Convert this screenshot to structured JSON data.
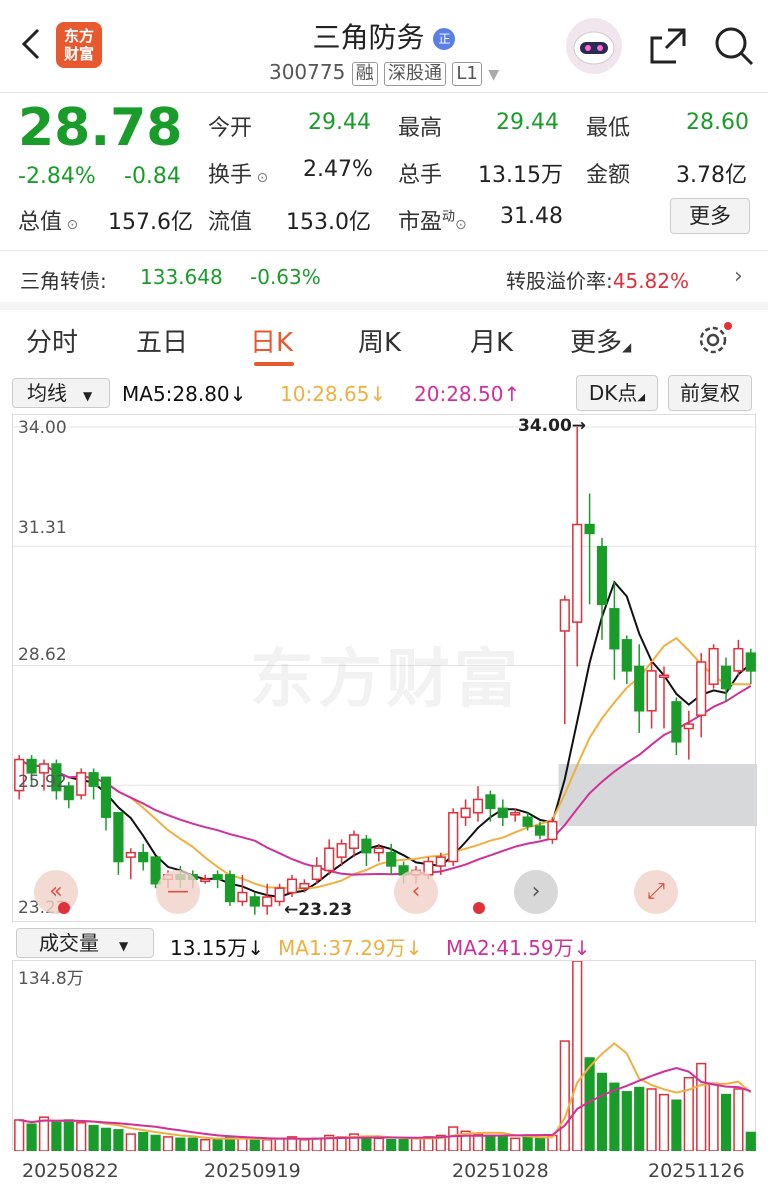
{
  "header": {
    "title": "三角防务",
    "code": "300775",
    "badges": [
      "融",
      "深股通",
      "L1"
    ],
    "logo_text": "东方\n财富",
    "title_badge": "正"
  },
  "quote": {
    "price": "28.78",
    "change_pct": "-2.84%",
    "change": "-0.84",
    "open_label": "今开",
    "open": "29.44",
    "high_label": "最高",
    "high": "29.44",
    "low_label": "最低",
    "low": "28.60",
    "turnover_label": "换手",
    "turnover": "2.47%",
    "volume_label": "总手",
    "volume": "13.15万",
    "amount_label": "金额",
    "amount": "3.78亿",
    "mcap_label": "总值",
    "mcap": "157.6亿",
    "float_label": "流值",
    "float": "153.0亿",
    "pe_label": "市盈",
    "pe_sup": "动",
    "pe": "31.48",
    "more": "更多"
  },
  "bond": {
    "label": "三角转债:",
    "price": "133.648",
    "change": "-0.63%",
    "premium_label": "转股溢价率:",
    "premium": "45.82%"
  },
  "tabs": [
    "分时",
    "五日",
    "日K",
    "周K",
    "月K",
    "更多"
  ],
  "ma_bar": {
    "select": "均线",
    "ma5": "MA5:28.80↓",
    "ma10": "10:28.65↓",
    "ma20": "20:28.50↑",
    "dk": "DK点",
    "adj": "前复权"
  },
  "kline": {
    "y_labels": [
      "34.00",
      "31.31",
      "28.62",
      "25.92",
      "23.22"
    ],
    "high_mark": "34.00→",
    "low_mark": "←23.23",
    "watermark": "东方财富"
  },
  "vol_bar": {
    "select": "成交量",
    "vol": "13.15万↓",
    "ma1": "MA1:37.29万↓",
    "ma2": "MA2:41.59万↓",
    "max_label": "134.8万"
  },
  "dates": [
    "20250822",
    "20250919",
    "20251028",
    "20251126"
  ],
  "colors": {
    "up": "#e0303a",
    "down": "#1a9c2a",
    "ma5": "#111111",
    "ma10": "#f0b040",
    "ma20": "#d0309a"
  },
  "chart_data": {
    "type": "candlestick",
    "ylim": [
      23.22,
      34.0
    ],
    "candles": [
      [
        25.8,
        26.5,
        25.6,
        26.6
      ],
      [
        26.5,
        26.2,
        25.9,
        26.6
      ],
      [
        26.2,
        26.4,
        25.8,
        26.5
      ],
      [
        26.4,
        25.8,
        25.6,
        26.5
      ],
      [
        25.9,
        25.6,
        25.4,
        26.0
      ],
      [
        25.7,
        26.2,
        25.6,
        26.3
      ],
      [
        26.2,
        25.9,
        25.6,
        26.3
      ],
      [
        26.1,
        25.2,
        24.9,
        26.1
      ],
      [
        25.3,
        24.2,
        23.9,
        25.3
      ],
      [
        24.3,
        24.4,
        23.8,
        24.5
      ],
      [
        24.4,
        24.2,
        24.0,
        24.6
      ],
      [
        24.3,
        23.7,
        23.6,
        24.3
      ],
      [
        23.8,
        23.9,
        23.6,
        24.0
      ],
      [
        23.9,
        23.8,
        23.6,
        24.1
      ],
      [
        23.9,
        23.8,
        23.6,
        24.0
      ],
      [
        23.8,
        23.8,
        23.7,
        23.9
      ],
      [
        23.9,
        23.8,
        23.6,
        24.0
      ],
      [
        23.9,
        23.3,
        23.2,
        24.0
      ],
      [
        23.3,
        23.5,
        23.2,
        23.9
      ],
      [
        23.4,
        23.2,
        23.0,
        23.5
      ],
      [
        23.2,
        23.4,
        23.0,
        23.7
      ],
      [
        23.3,
        23.6,
        23.2,
        23.7
      ],
      [
        23.5,
        23.8,
        23.4,
        23.9
      ],
      [
        23.6,
        23.7,
        23.5,
        23.8
      ],
      [
        23.8,
        24.1,
        23.7,
        24.3
      ],
      [
        24.0,
        24.5,
        23.9,
        24.7
      ],
      [
        24.3,
        24.6,
        24.1,
        24.7
      ],
      [
        24.5,
        24.8,
        24.3,
        24.9
      ],
      [
        24.7,
        24.4,
        24.1,
        24.8
      ],
      [
        24.4,
        24.5,
        24.2,
        24.6
      ],
      [
        24.4,
        24.1,
        23.9,
        24.6
      ],
      [
        24.1,
        23.9,
        23.7,
        24.2
      ],
      [
        23.9,
        24.0,
        23.7,
        24.1
      ],
      [
        23.9,
        24.2,
        23.8,
        24.3
      ],
      [
        24.1,
        24.3,
        23.9,
        24.4
      ],
      [
        24.2,
        25.3,
        24.1,
        25.4
      ],
      [
        25.2,
        25.4,
        25.0,
        25.6
      ],
      [
        25.3,
        25.6,
        25.1,
        25.9
      ],
      [
        25.7,
        25.4,
        25.1,
        25.8
      ],
      [
        25.4,
        25.2,
        25.0,
        25.6
      ],
      [
        25.3,
        25.3,
        25.1,
        25.4
      ],
      [
        25.2,
        25.0,
        24.9,
        25.3
      ],
      [
        25.0,
        24.8,
        24.7,
        25.1
      ],
      [
        24.7,
        25.1,
        24.6,
        25.2
      ],
      [
        29.4,
        30.1,
        27.3,
        30.2
      ],
      [
        29.6,
        31.8,
        28.6,
        34.0
      ],
      [
        31.8,
        31.6,
        30.0,
        32.5
      ],
      [
        31.3,
        30.0,
        29.2,
        31.5
      ],
      [
        29.9,
        29.0,
        28.3,
        30.5
      ],
      [
        29.2,
        28.5,
        28.2,
        29.3
      ],
      [
        28.6,
        27.6,
        27.1,
        29.1
      ],
      [
        27.6,
        28.5,
        27.2,
        28.7
      ],
      [
        28.4,
        28.4,
        27.2,
        28.6
      ],
      [
        27.8,
        26.9,
        26.6,
        27.9
      ],
      [
        27.2,
        27.3,
        26.5,
        27.6
      ],
      [
        27.5,
        28.7,
        27.0,
        28.9
      ],
      [
        28.2,
        29.0,
        28.1,
        29.1
      ],
      [
        28.6,
        28.1,
        27.8,
        28.8
      ],
      [
        28.5,
        29.0,
        28.4,
        29.2
      ],
      [
        28.9,
        28.5,
        28.2,
        29.0
      ]
    ],
    "volumes": [
      22,
      19,
      24,
      21,
      22,
      20,
      18,
      16,
      15,
      12,
      13,
      11,
      10,
      9,
      9,
      8,
      8,
      10,
      9,
      8,
      8,
      9,
      10,
      8,
      9,
      11,
      10,
      12,
      10,
      9,
      8,
      8,
      9,
      10,
      11,
      17,
      14,
      12,
      11,
      10,
      9,
      10,
      9,
      11,
      78,
      134.8,
      66,
      55,
      48,
      42,
      45,
      44,
      40,
      36,
      52,
      62,
      48,
      40,
      44,
      13.15
    ]
  }
}
